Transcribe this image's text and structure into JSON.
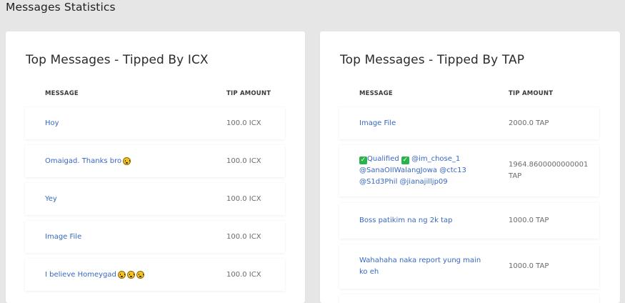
{
  "page": {
    "title": "Messages Statistics"
  },
  "icx_card": {
    "title": "Top Messages - Tipped By ICX",
    "col_message": "MESSAGE",
    "col_tip": "TIP AMOUNT",
    "rows": [
      {
        "message": "Hoy",
        "amount": "100.0 ICX"
      },
      {
        "message": "Omaigad. Thanks bro",
        "emoji": "hugging-face",
        "amount": "100.0 ICX"
      },
      {
        "message": "Yey",
        "amount": "100.0 ICX"
      },
      {
        "message": "Image File",
        "amount": "100.0 ICX"
      },
      {
        "message": "I believe Homeygad",
        "emoji": "grinning-face x3",
        "amount": "100.0 ICX"
      }
    ]
  },
  "tap_card": {
    "title": "Top Messages - Tipped By TAP",
    "col_message": "MESSAGE",
    "col_tip": "TIP AMOUNT",
    "rows": [
      {
        "message": "Image File",
        "amount": "2000.0 TAP"
      },
      {
        "message_parts": [
          "Qualified",
          "@im_chose_1",
          "@SanaOIIWalangJowa @ctc13",
          "@S1d3Phil @jianajilljp09"
        ],
        "emoji": "check-mark x2",
        "amount_line1": "1964.8600000000001",
        "amount_line2": "TAP"
      },
      {
        "message": "Boss patikim na ng 2k tap",
        "amount": "1000.0 TAP"
      },
      {
        "message_line1": "Wahahaha naka report yung main",
        "message_line2": "ko eh",
        "amount": "1000.0 TAP"
      }
    ]
  }
}
